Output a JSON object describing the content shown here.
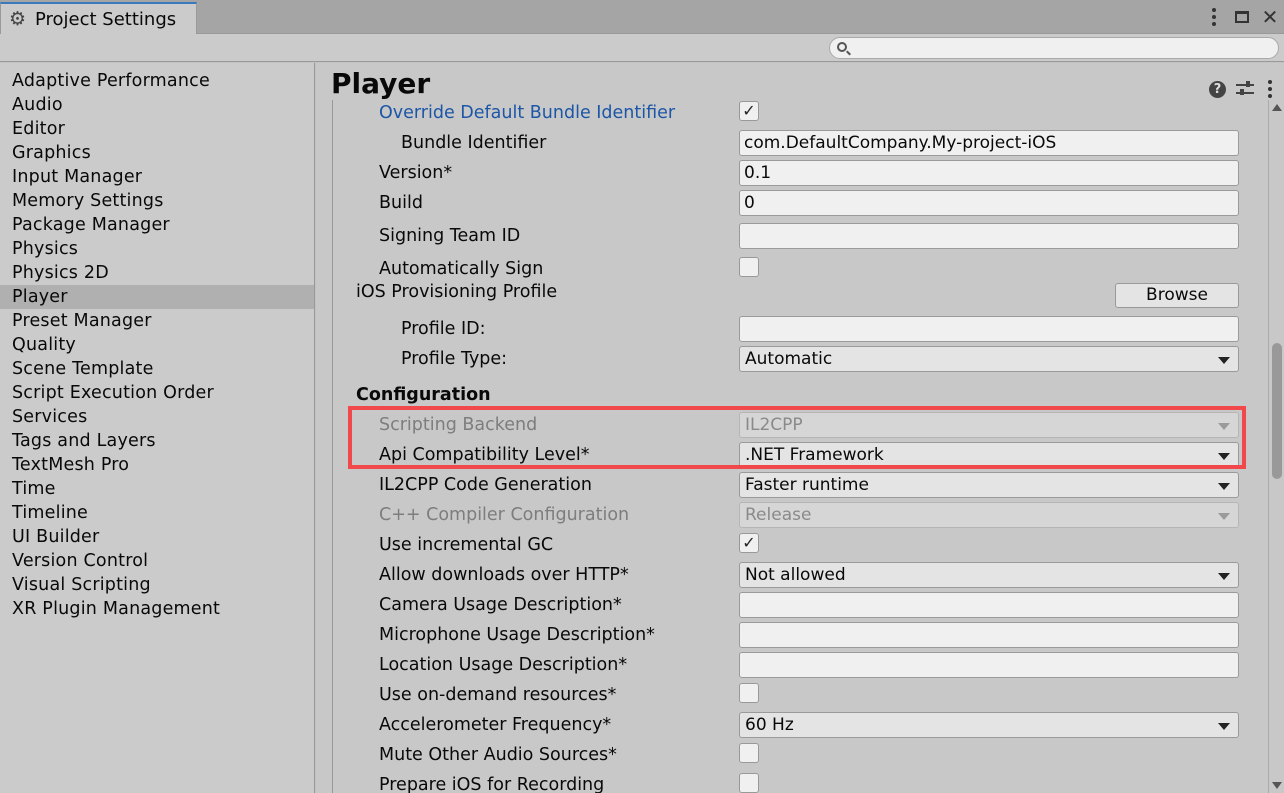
{
  "window": {
    "tab_title": "Project Settings",
    "tab_icon": "gear-icon",
    "controls": [
      "kebab-menu-icon",
      "maximize-icon",
      "close-icon"
    ]
  },
  "search": {
    "placeholder": "",
    "value": ""
  },
  "sidebar": {
    "selected": "Player",
    "items": [
      {
        "label": "Adaptive Performance"
      },
      {
        "label": "Audio"
      },
      {
        "label": "Editor"
      },
      {
        "label": "Graphics"
      },
      {
        "label": "Input Manager"
      },
      {
        "label": "Memory Settings"
      },
      {
        "label": "Package Manager"
      },
      {
        "label": "Physics"
      },
      {
        "label": "Physics 2D"
      },
      {
        "label": "Player"
      },
      {
        "label": "Preset Manager"
      },
      {
        "label": "Quality"
      },
      {
        "label": "Scene Template"
      },
      {
        "label": "Script Execution Order"
      },
      {
        "label": "Services"
      },
      {
        "label": "Tags and Layers"
      },
      {
        "label": "TextMesh Pro"
      },
      {
        "label": "Time"
      },
      {
        "label": "Timeline"
      },
      {
        "label": "UI Builder"
      },
      {
        "label": "Version Control"
      },
      {
        "label": "Visual Scripting"
      },
      {
        "label": "XR Plugin Management"
      }
    ]
  },
  "main": {
    "title": "Player",
    "header_icons": [
      "help-icon",
      "preset-icon",
      "more-icon"
    ],
    "rows": {
      "override_bundle": {
        "label": "Override Default Bundle Identifier",
        "checked": true,
        "check_glyph": "✓"
      },
      "bundle_id": {
        "label": "Bundle Identifier",
        "value": "com.DefaultCompany.My-project-iOS"
      },
      "version": {
        "label": "Version*",
        "value": "0.1"
      },
      "build": {
        "label": "Build",
        "value": "0"
      },
      "signing_team": {
        "label": "Signing Team ID",
        "value": ""
      },
      "auto_sign": {
        "label": "Automatically Sign",
        "checked": false
      },
      "provisioning": {
        "label": "iOS Provisioning Profile",
        "button": "Browse"
      },
      "profile_id": {
        "label": "Profile ID:",
        "value": ""
      },
      "profile_type": {
        "label": "Profile Type:",
        "value": "Automatic"
      },
      "configuration": {
        "label": "Configuration"
      },
      "scripting_backend": {
        "label": "Scripting Backend",
        "value": "IL2CPP",
        "disabled": true
      },
      "api_level": {
        "label": "Api Compatibility Level*",
        "value": ".NET Framework"
      },
      "il2cpp_codegen": {
        "label": "IL2CPP Code Generation",
        "value": "Faster runtime"
      },
      "cpp_compiler": {
        "label": "C++ Compiler Configuration",
        "value": "Release",
        "disabled": true
      },
      "incremental_gc": {
        "label": "Use incremental GC",
        "checked": true,
        "check_glyph": "✓"
      },
      "downloads_http": {
        "label": "Allow downloads over HTTP*",
        "value": "Not allowed"
      },
      "camera_usage": {
        "label": "Camera Usage Description*",
        "value": ""
      },
      "mic_usage": {
        "label": "Microphone Usage Description*",
        "value": ""
      },
      "location_usage": {
        "label": "Location Usage Description*",
        "value": ""
      },
      "on_demand": {
        "label": "Use on-demand resources*",
        "checked": false
      },
      "accelerometer": {
        "label": "Accelerometer Frequency*",
        "value": "60 Hz"
      },
      "mute_audio": {
        "label": "Mute Other Audio Sources*",
        "checked": false
      },
      "prepare_recording": {
        "label": "Prepare iOS for Recording",
        "checked": false
      }
    }
  },
  "colors": {
    "highlight_box": "#f0484b",
    "link_blue": "#1c56a6",
    "tab_accent": "#3a79bb"
  }
}
